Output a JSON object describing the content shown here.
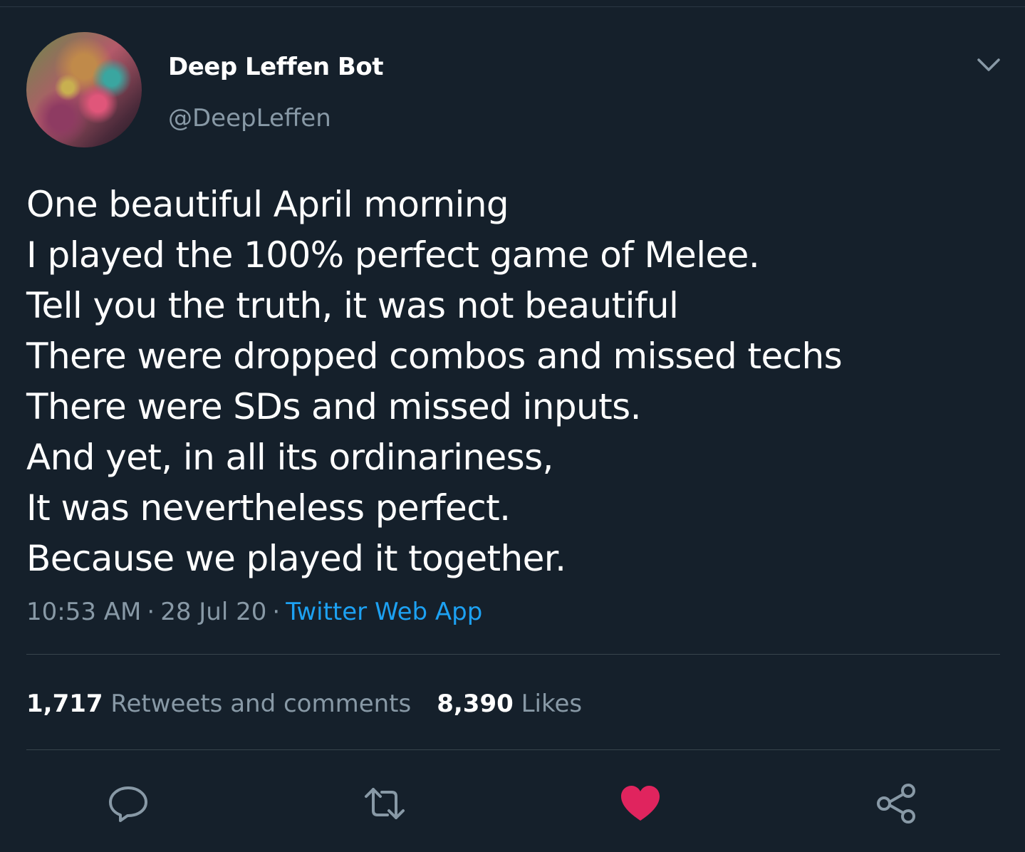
{
  "colors": {
    "background": "#15202b",
    "text_primary": "#ffffff",
    "text_secondary": "#8899a6",
    "link": "#1da1f2",
    "like_active": "#e0245e",
    "divider": "#38444d"
  },
  "author": {
    "display_name": "Deep Leffen Bot",
    "handle": "@DeepLeffen",
    "avatar_icon": "profile-avatar"
  },
  "tweet": {
    "lines": [
      "One beautiful April morning",
      "I played the 100% perfect game of Melee.",
      "Tell you the truth, it was not beautiful",
      "There were dropped combos and missed techs",
      "There were SDs and missed inputs.",
      "And yet, in all its ordinariness,",
      "It was nevertheless perfect.",
      "Because we played it together."
    ]
  },
  "meta": {
    "time": "10:53 AM",
    "separator": "·",
    "date": "28 Jul 20",
    "source": "Twitter Web App"
  },
  "stats": {
    "retweets_count": "1,717",
    "retweets_label": "Retweets and comments",
    "likes_count": "8,390",
    "likes_label": "Likes"
  },
  "actions": {
    "reply_icon": "comment-bubble-icon",
    "retweet_icon": "retweet-arrows-icon",
    "like_icon": "heart-icon",
    "like_active": true,
    "share_icon": "share-nodes-icon",
    "menu_icon": "chevron-down-icon"
  }
}
